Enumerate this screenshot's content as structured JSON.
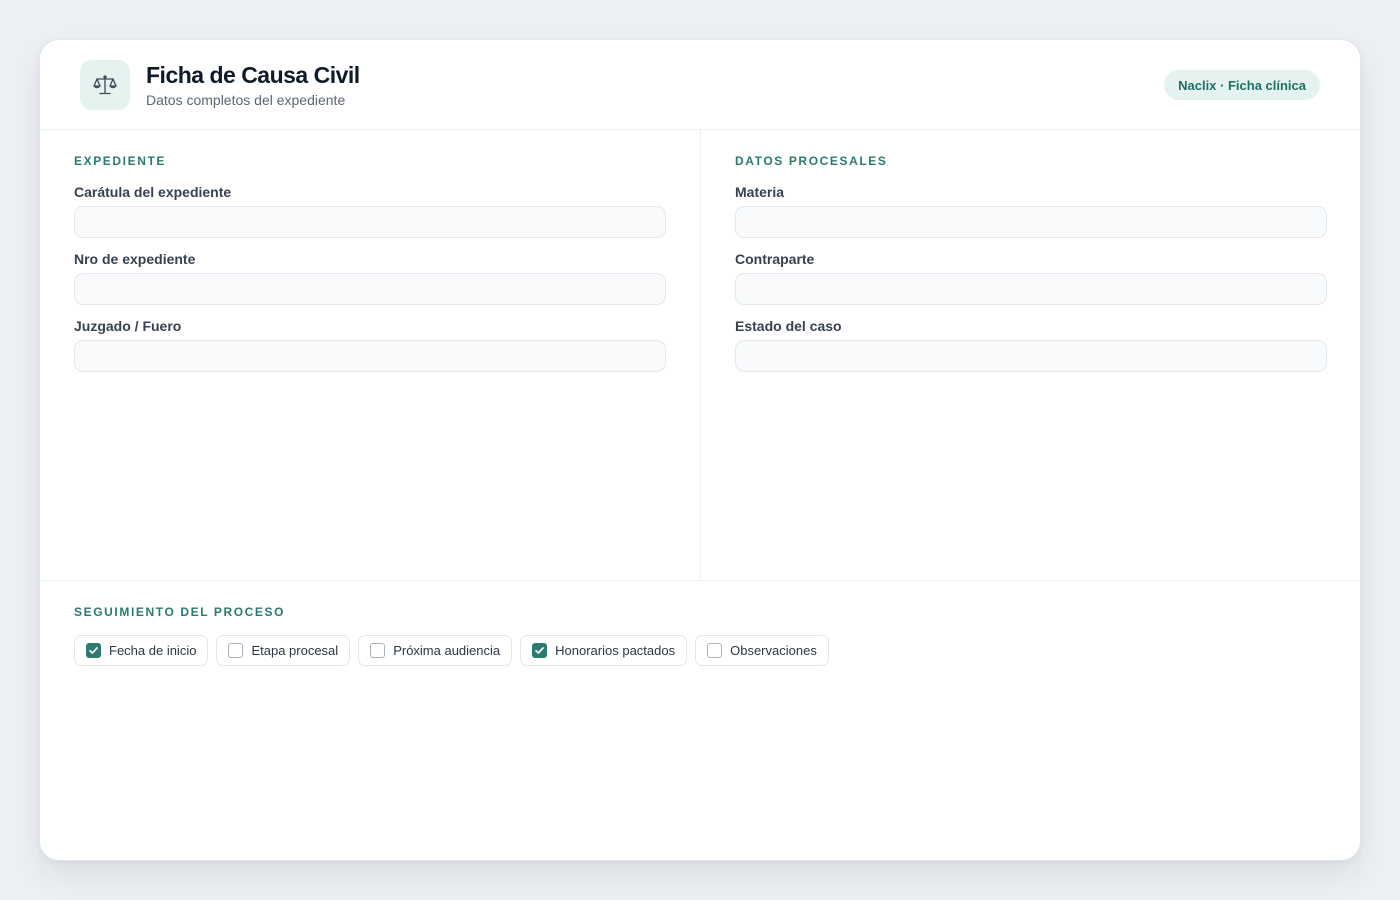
{
  "header": {
    "title": "Ficha de Causa Civil",
    "subtitle": "Datos completos del expediente",
    "badge": "Naclix · Ficha clínica",
    "logo_icon": "scales-icon"
  },
  "expediente": {
    "section_title": "EXPEDIENTE",
    "fields": [
      {
        "label": "Carátula del expediente",
        "value": ""
      },
      {
        "label": "Nro de expediente",
        "value": ""
      },
      {
        "label": "Juzgado / Fuero",
        "value": ""
      }
    ]
  },
  "procesales": {
    "section_title": "DATOS PROCESALES",
    "fields": [
      {
        "label": "Materia",
        "value": ""
      },
      {
        "label": "Contraparte",
        "value": ""
      },
      {
        "label": "Estado del caso",
        "value": ""
      }
    ]
  },
  "seguimiento": {
    "section_title": "SEGUIMIENTO DEL PROCESO",
    "options": [
      {
        "label": "Fecha de inicio",
        "checked": true
      },
      {
        "label": "Etapa procesal",
        "checked": false
      },
      {
        "label": "Próxima audiencia",
        "checked": false
      },
      {
        "label": "Honorarios pactados",
        "checked": true
      },
      {
        "label": "Observaciones",
        "checked": false
      }
    ]
  },
  "colors": {
    "accent": "#2c7a70",
    "badge_bg": "#e4f3ef"
  }
}
